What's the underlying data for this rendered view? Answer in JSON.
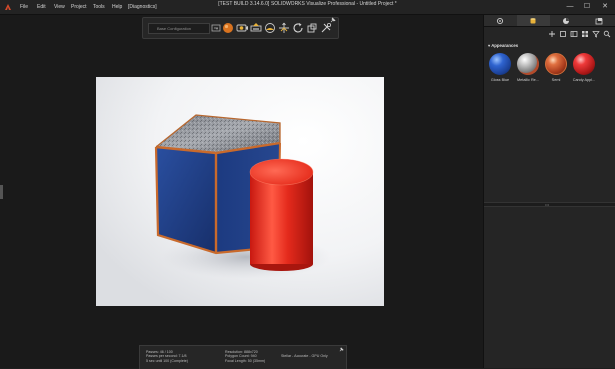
{
  "app": {
    "title_prefix": "[TEST BUILD 3.14.6.0]",
    "title": "SOLIDWORKS Visualize Professional - Untitled Project *"
  },
  "menu": {
    "items": [
      "File",
      "Edit",
      "View",
      "Project",
      "Tools",
      "Help",
      "[Diagnostics]"
    ]
  },
  "window_controls": {
    "minimize": "—",
    "maximize": "☐",
    "close": "✕"
  },
  "toolbar": {
    "config_placeholder": "Base Configuration",
    "icons": [
      "configuration-icon",
      "render-mode-icon",
      "camera-icon",
      "environment-icon",
      "appearance-icon",
      "select-tool-icon",
      "rotate-tool-icon",
      "scale-tool-icon",
      "tools-icon"
    ]
  },
  "status": {
    "passes": "Passes: 46 / 100",
    "passes_per_second": "Passes per second: 7.1/8",
    "time": "5 sec until 100 (Complete)",
    "resolution": "Resolution: 888x720",
    "polygon_count": "Polygon Count: 940",
    "focal_length": "Focal Length: 50 (35mm)",
    "mode": "Stellar - Accurate - GPU Only"
  },
  "panel": {
    "tabs": [
      "settings-tab",
      "models-tab",
      "appearances-tab",
      "scenes-tab"
    ],
    "section_header": "Appearances",
    "swatches": [
      {
        "label": "Gloss Blue",
        "color": "#1f4fa8"
      },
      {
        "label": "Metallic Re...",
        "color": "#9a9a9a"
      },
      {
        "label": "Semi",
        "color": "#c0502a"
      },
      {
        "label": "Candy Appl...",
        "color": "#d22a2a"
      }
    ]
  },
  "colors": {
    "accent": "#e8b23a",
    "cube_blue": "#1d3f8c",
    "cylinder_red": "#e02418",
    "edge_copper": "#c96a2c"
  }
}
